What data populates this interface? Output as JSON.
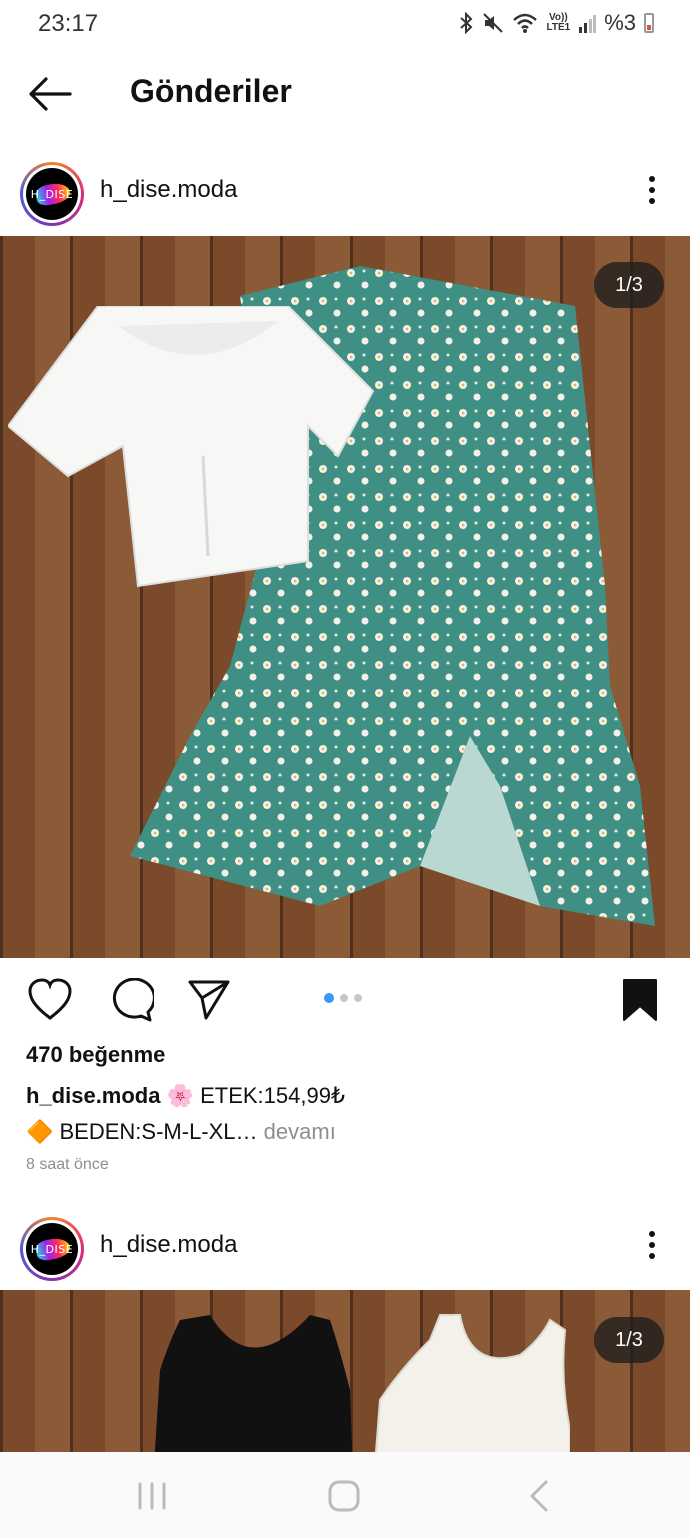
{
  "status_bar": {
    "time": "23:17",
    "lte_top": "Vo))",
    "lte_bottom": "LTE1",
    "battery": "%3"
  },
  "header": {
    "title": "Gönderiler"
  },
  "posts": [
    {
      "avatar_text": "H_DISE",
      "username": "h_dise.moda",
      "counter": "1/3",
      "likes": "470 beğenme",
      "caption_user": "h_dise.moda",
      "caption_line1": " 🌸 ETEK:154,99₺",
      "caption_line2": "🔶 BEDEN:S-M-L-XL…",
      "caption_more": " devamı",
      "timestamp": "8 saat önce"
    },
    {
      "avatar_text": "H_DISE",
      "username": "h_dise.moda",
      "counter": "1/3"
    }
  ],
  "colors": {
    "accent_dot": "#3897f0",
    "skirt": "#3f8f85",
    "wood": "#7a4a2b"
  },
  "icons": [
    "back-arrow-icon",
    "bluetooth-icon",
    "mute-icon",
    "wifi-icon",
    "signal-icon",
    "battery-icon",
    "more-vertical-icon",
    "heart-icon",
    "comment-icon",
    "share-icon",
    "bookmark-icon",
    "recent-apps-icon",
    "home-icon",
    "back-nav-icon"
  ]
}
